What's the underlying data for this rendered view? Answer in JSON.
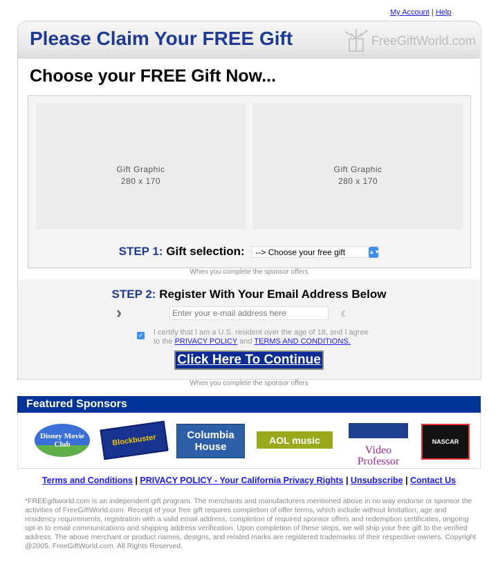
{
  "top_links": {
    "my_account": "My Account",
    "sep": "|",
    "help": "Help"
  },
  "header": {
    "title": "Please Claim Your FREE Gift",
    "logo_text": "FreeGiftWorld.com"
  },
  "heading": "Choose your FREE Gift Now...",
  "gifts": [
    {
      "label": "Gift Graphic",
      "size": "280 x 170"
    },
    {
      "label": "Gift Graphic",
      "size": "280 x 170"
    }
  ],
  "step1": {
    "num": "STEP 1:",
    "label": "Gift selection:",
    "select_value": "--> Choose your free gift"
  },
  "caption": "When you complete the sponsor offers",
  "step2": {
    "num": "STEP 2:",
    "label": "Register With Your Email Address Below",
    "email_placeholder": "Enter your e-mail address here",
    "certify_text": "I certify that I am a U.S. resident over the age of 18, and I agree to the",
    "privacy": "PRIVACY POLICY",
    "and": "and",
    "terms": "TERMS AND CONDITIONS.",
    "checked": true,
    "button": "Click Here To Continue"
  },
  "sponsors": {
    "title": "Featured Sponsors",
    "logos": [
      "Disney Movie Club",
      "Blockbuster",
      "Columbia House",
      "AOL music",
      "Video Professor",
      "NASCAR"
    ]
  },
  "footer_links": [
    "Terms and Conditions",
    "PRIVACY POLICY - Your California Privacy Rights",
    "Unsubscribe",
    "Contact Us"
  ],
  "disclaimer": "*FREEgiftworld.com is an independent gift program. The merchants and manufacturers mentioned above in no way endorse or sponsor the activities of FreeGiftWorld.com. Receipt of your free gift requires completion of offer terms, which include without limitation; age and residency requirements, registration with a valid email address, completion of required sponsor offers and redemption certificates, ongoing opt-in to email communications and shipping address verification. Upon completion of these steps, we will ship your free gift to the verified address. The above merchant or product names, designs, and related marks are registered trademarks of their respective owners. Copyright @2005. FreeGiftWorld.com. All Rights Reserved."
}
